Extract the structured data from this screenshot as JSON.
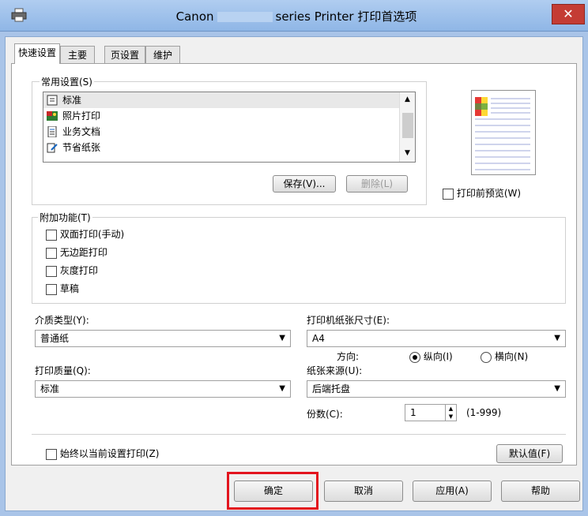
{
  "window": {
    "title_prefix": "Canon",
    "title_suffix": "series Printer 打印首选项",
    "close_label": "✕"
  },
  "tabs": [
    {
      "label": "快速设置"
    },
    {
      "label": "主要"
    },
    {
      "label": "页设置"
    },
    {
      "label": "维护"
    }
  ],
  "common_settings": {
    "label": "常用设置(S)",
    "items": [
      {
        "label": "标准"
      },
      {
        "label": "照片打印"
      },
      {
        "label": "业务文档"
      },
      {
        "label": "节省纸张"
      }
    ],
    "save_label": "保存(V)...",
    "delete_label": "删除(L)"
  },
  "preview": {
    "label": "打印前预览(W)"
  },
  "additional": {
    "label": "附加功能(T)",
    "items": [
      {
        "label": "双面打印(手动)"
      },
      {
        "label": "无边距打印"
      },
      {
        "label": "灰度打印"
      },
      {
        "label": "草稿"
      }
    ]
  },
  "media_type": {
    "label": "介质类型(Y):",
    "value": "普通纸"
  },
  "printer_paper_size": {
    "label": "打印机纸张尺寸(E):",
    "value": "A4"
  },
  "orientation": {
    "label": "方向:",
    "portrait": "纵向(I)",
    "landscape": "横向(N)"
  },
  "print_quality": {
    "label": "打印质量(Q):",
    "value": "标准"
  },
  "paper_source": {
    "label": "纸张来源(U):",
    "value": "后端托盘"
  },
  "copies": {
    "label": "份数(C):",
    "value": "1",
    "range": "(1-999)"
  },
  "always_print": {
    "label": "始终以当前设置打印(Z)"
  },
  "defaults_label": "默认值(F)",
  "footer": {
    "ok": "确定",
    "cancel": "取消",
    "apply": "应用(A)",
    "help": "帮助"
  },
  "colors": {
    "titlebar": "#9cbfe9",
    "close": "#c43c34",
    "highlight": "#e3141e"
  }
}
